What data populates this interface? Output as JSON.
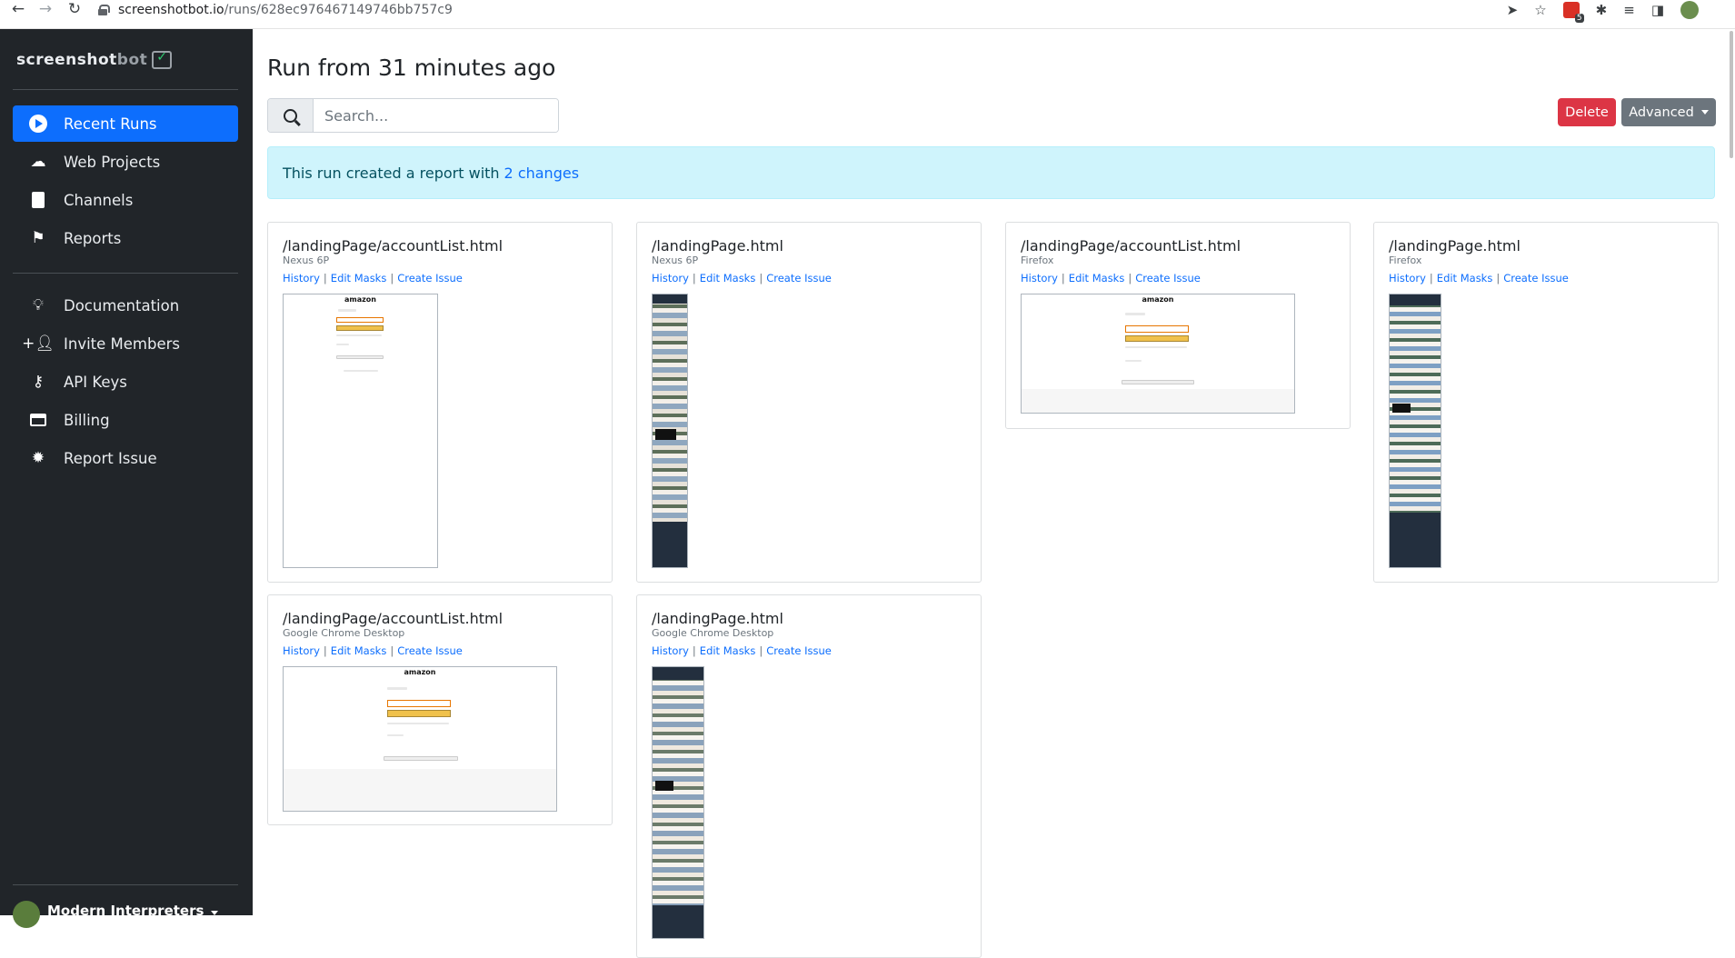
{
  "browser": {
    "url_host": "screenshotbot.io",
    "url_path": "/runs/628ec976467149746bb757c9",
    "ext_badge_count": "5"
  },
  "sidebar": {
    "logo_white": "screenshot",
    "logo_gray": "bot",
    "items": [
      {
        "label": "Recent Runs",
        "icon": "play-circle-icon"
      },
      {
        "label": "Web Projects",
        "icon": "cloud-icon"
      },
      {
        "label": "Channels",
        "icon": "book-icon"
      },
      {
        "label": "Reports",
        "icon": "flag-icon"
      },
      {
        "label": "Documentation",
        "icon": "lightbulb-icon"
      },
      {
        "label": "Invite Members",
        "icon": "person-add-icon"
      },
      {
        "label": "API Keys",
        "icon": "key-icon"
      },
      {
        "label": "Billing",
        "icon": "credit-card-icon"
      },
      {
        "label": "Report Issue",
        "icon": "bug-icon"
      }
    ],
    "user": "Modern Interpreters"
  },
  "main": {
    "title": "Run from 31 minutes ago",
    "search_placeholder": "Search...",
    "delete_label": "Delete",
    "advanced_label": "Advanced",
    "alert_text": "This run created a report with",
    "alert_link": "2 changes",
    "link_history": "History",
    "link_edit_masks": "Edit Masks",
    "link_create_issue": "Create Issue",
    "link_sep": "|",
    "cards": [
      {
        "path": "/landingPage/accountList.html",
        "device": "Nexus 6P"
      },
      {
        "path": "/landingPage.html",
        "device": "Nexus 6P"
      },
      {
        "path": "/landingPage/accountList.html",
        "device": "Firefox"
      },
      {
        "path": "/landingPage.html",
        "device": "Firefox"
      },
      {
        "path": "/landingPage/accountList.html",
        "device": "Google Chrome Desktop"
      },
      {
        "path": "/landingPage.html",
        "device": "Google Chrome Desktop"
      }
    ]
  }
}
